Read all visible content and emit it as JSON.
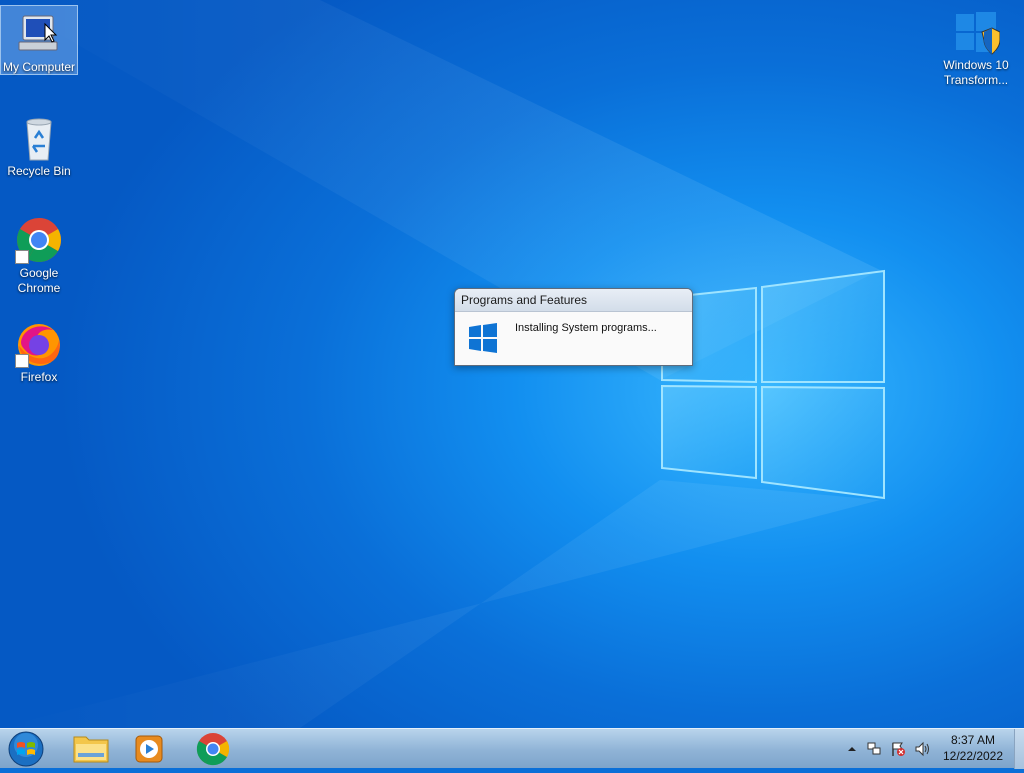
{
  "desktop": {
    "icons": [
      {
        "label": "My Computer",
        "icon": "computer-icon"
      },
      {
        "label": "Recycle Bin",
        "icon": "recycle-bin-icon"
      },
      {
        "label_line1": "Google",
        "label_line2": "Chrome",
        "icon": "chrome-icon"
      },
      {
        "label": "Firefox",
        "icon": "firefox-icon"
      },
      {
        "label_line1": "Windows 10",
        "label_line2": "Transform...",
        "icon": "windows-shield-icon"
      }
    ]
  },
  "dialog": {
    "title": "Programs and Features",
    "message": "Installing System programs...",
    "icon": "windows-logo-icon"
  },
  "taskbar": {
    "apps": [
      "file-explorer-icon",
      "media-player-icon",
      "chrome-icon"
    ],
    "clock_time": "8:37 AM",
    "clock_date": "12/22/2022"
  },
  "colors": {
    "wallpaper": "#0a6fd8",
    "accent": "#0078d7",
    "taskbar": "#8fb3d6"
  }
}
